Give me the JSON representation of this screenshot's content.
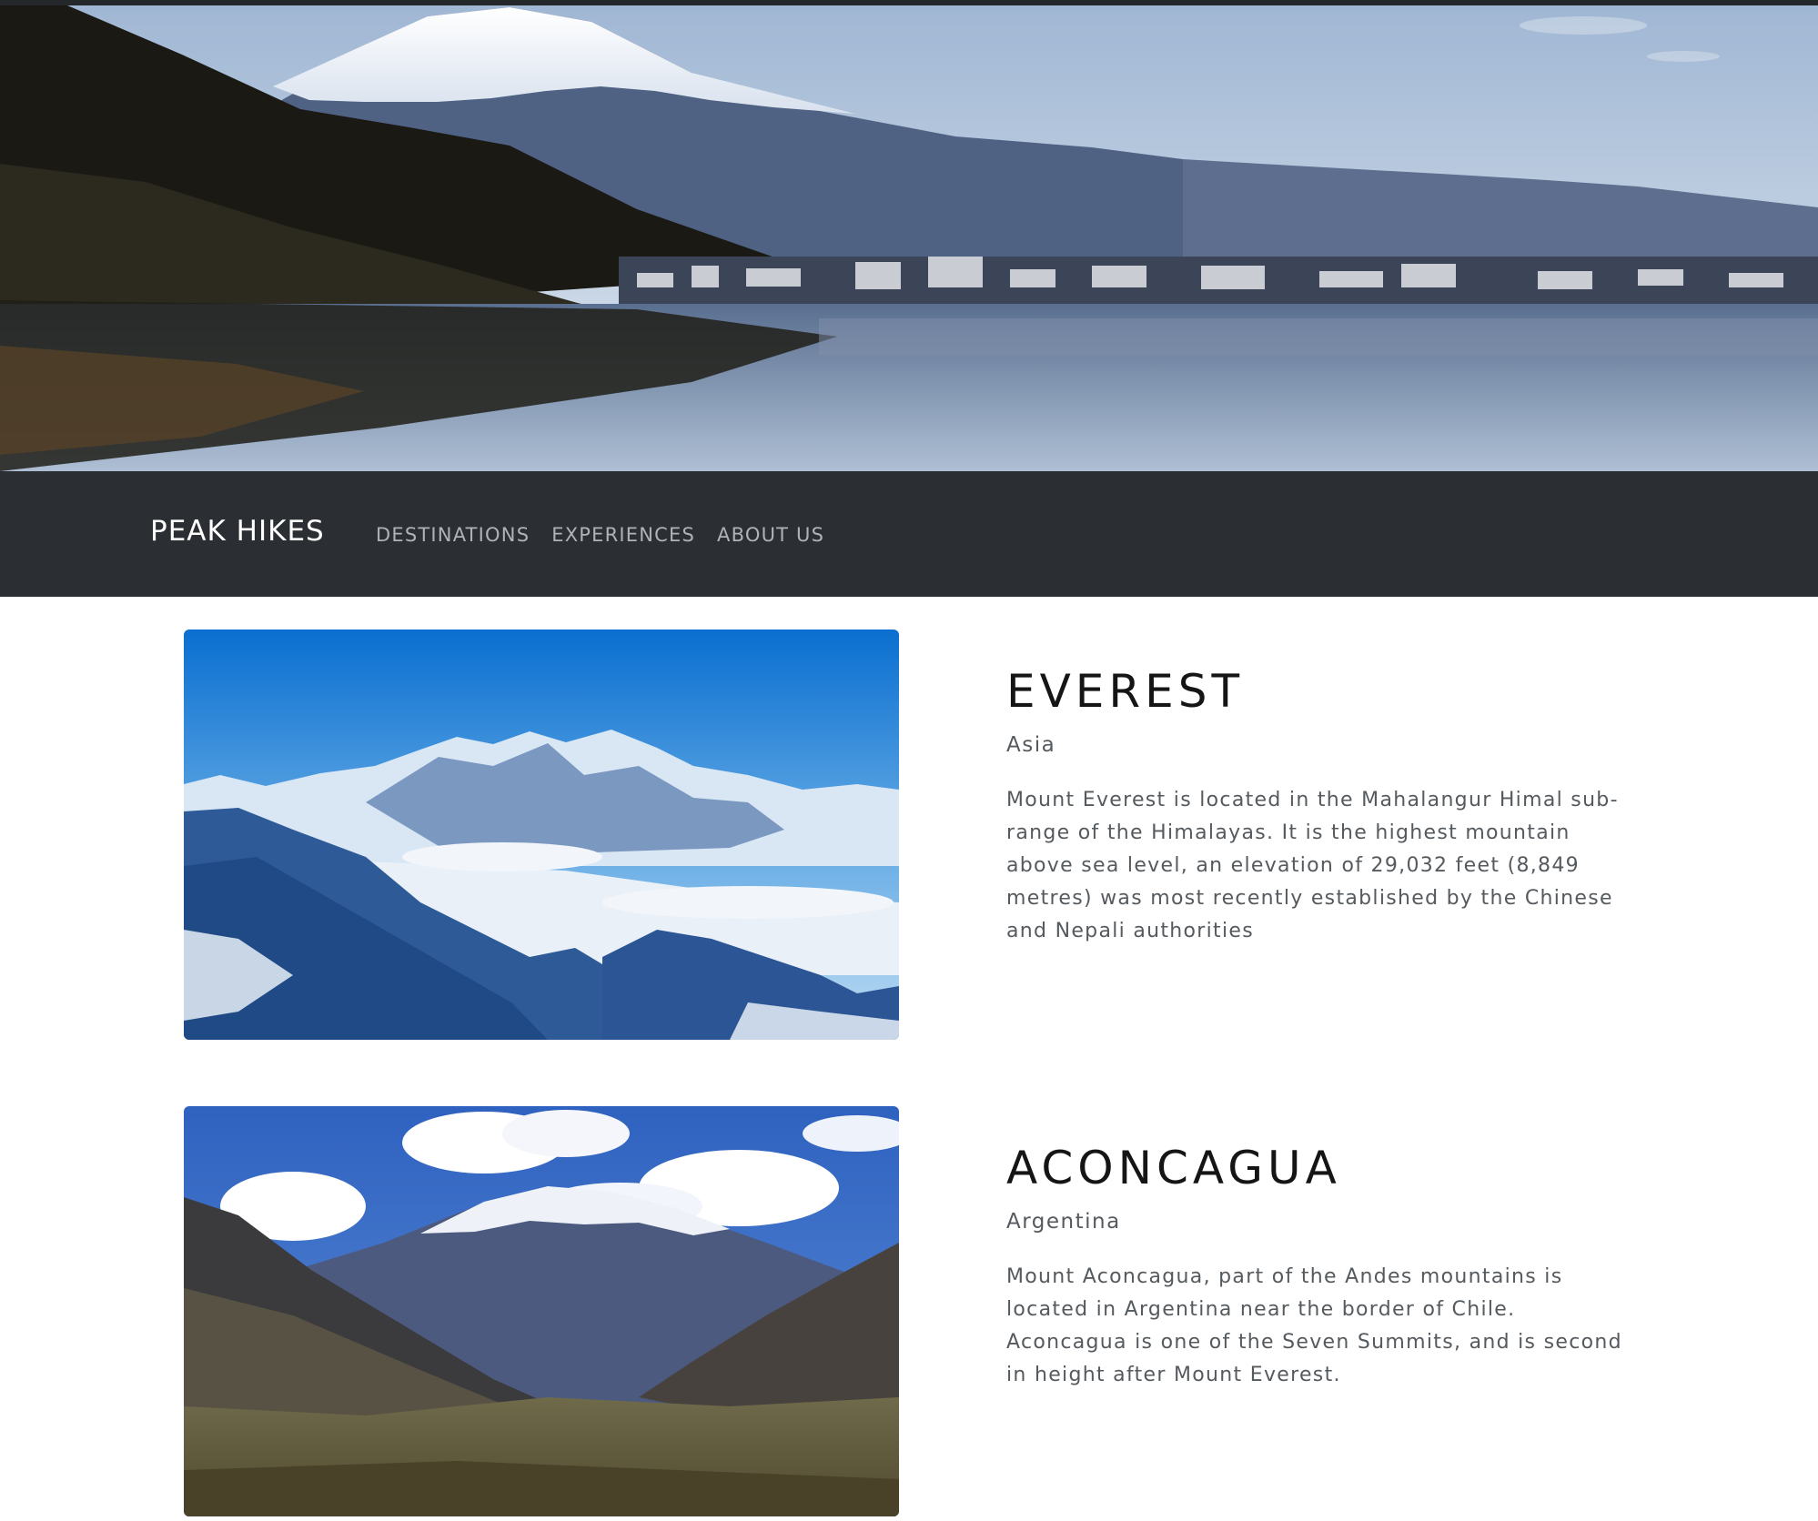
{
  "hero": {
    "image": "mountain-lake-town-photo"
  },
  "navbar": {
    "brand": "PEAK HIKES",
    "links": [
      {
        "label": "DESTINATIONS"
      },
      {
        "label": "EXPERIENCES"
      },
      {
        "label": "ABOUT US"
      }
    ],
    "colors": {
      "background": "#2b2f33",
      "brand": "#ffffff",
      "link": "#aeb3b8"
    }
  },
  "destinations": [
    {
      "title": "EVEREST",
      "region": "Asia",
      "description": "Mount Everest is located in the Mahalangur Himal sub-range of the Himalayas. It is the highest mountain above sea level, an elevation of 29,032 feet (8,849 metres) was most recently established by the Chinese and Nepali authorities",
      "image": "snowy-mountain-range-photo"
    },
    {
      "title": "ACONCAGUA",
      "region": "Argentina",
      "description": "Mount Aconcagua, part of the Andes mountains is located in Argentina near the border of Chile. Aconcagua is one of the Seven Summits, and is second in height after Mount Everest.",
      "image": "andes-valley-photo"
    }
  ]
}
